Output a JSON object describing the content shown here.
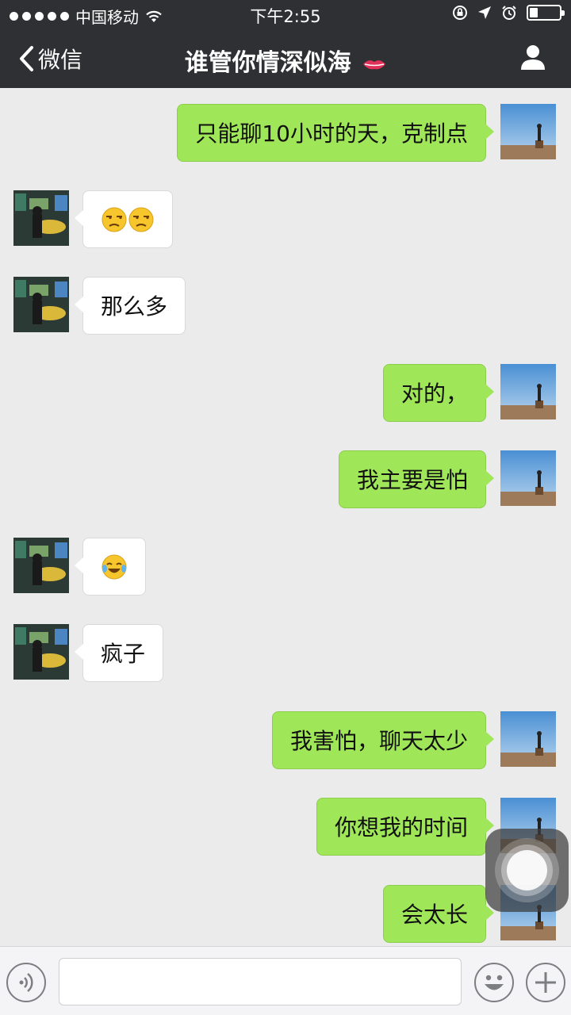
{
  "status_bar": {
    "carrier": "中国移动",
    "time": "下午2:55",
    "battery_level": 0.2
  },
  "nav": {
    "back_label": "微信",
    "title": "谁管你情深似海"
  },
  "messages": [
    {
      "side": "right",
      "text": "只能聊10小时的天，克制点"
    },
    {
      "side": "left",
      "text": "",
      "emojis": [
        "unamused-face",
        "unamused-face"
      ]
    },
    {
      "side": "left",
      "text": "那么多"
    },
    {
      "side": "right",
      "text": "对的，"
    },
    {
      "side": "right",
      "text": "我主要是怕"
    },
    {
      "side": "left",
      "text": "",
      "emojis": [
        "tears-of-joy-face"
      ]
    },
    {
      "side": "left",
      "text": "疯子"
    },
    {
      "side": "right",
      "text": "我害怕，聊天太少"
    },
    {
      "side": "right",
      "text": "你想我的时间"
    },
    {
      "side": "right",
      "text": "会太长"
    }
  ],
  "input_bar": {
    "value": "",
    "icons": [
      "voice-icon",
      "emoji-face-icon",
      "plus-icon"
    ]
  },
  "colors": {
    "nav_bg": "#2f3033",
    "chat_bg": "#ebebeb",
    "bubble_right": "#9fe658",
    "bubble_left": "#ffffff"
  }
}
